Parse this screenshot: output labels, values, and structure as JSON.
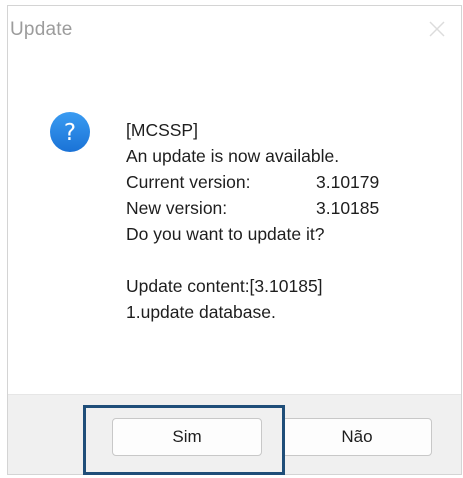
{
  "window": {
    "title": "Update",
    "close_icon": "close-icon"
  },
  "icon": {
    "name": "question-icon",
    "glyph": "?",
    "color": "#1f86e5"
  },
  "message": {
    "line1": "[MCSSP]",
    "line2": "An update is now available.",
    "current_label": "Current version:",
    "current_value": "3.10179",
    "new_label": "New version:",
    "new_value": "3.10185",
    "question": "Do you want to update it?",
    "content_line": "Update content:[3.10185]",
    "content_item": "1.update database."
  },
  "buttons": {
    "yes_label": "Sim",
    "no_label": "Não"
  },
  "highlight_color": "#1f4e79"
}
